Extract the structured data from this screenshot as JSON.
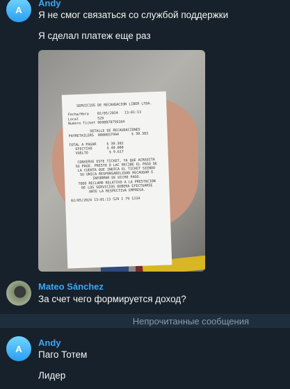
{
  "messages": [
    {
      "sender": "Andy",
      "avatar_letter": "A",
      "lines": [
        "Я не смог связаться со службой поддержки",
        "Я сделал платеж еще раз"
      ],
      "has_photo": true
    },
    {
      "sender": "Mateo Sánchez",
      "lines": [
        "За счет чего формируется доход?"
      ]
    },
    {
      "sender": "Andy",
      "avatar_letter": "A",
      "lines": [
        "Паго Тотем",
        "Лидер"
      ]
    }
  ],
  "unread_divider": "Непрочитанные сообщения",
  "receipt": {
    "header": "SERVICIOS DE RECAUDACION LIBER LTDA.",
    "fecha": "Fecha/Hora    02/05/2024   13:01:13",
    "local": "Local         529",
    "ticket": "Numero Ticket 9690878756164",
    "detalle": "DETALLE DE RECAUDACIONES",
    "payretailers": "PAYRETAILERS  0000037994      $ 30.383",
    "total": "TOTAL A PAGAR     $ 30.383",
    "efectivo": "   EFECTIVO       $ 40.000",
    "vuelto": "   VUELTO          $ 9.617",
    "notice": "CONSERVE ESTE TICKET, YA QUE ACREDITA\nSU PAGO. PRESTO O LAC RECIBE EL PAGO DE\nLA CUENTA QUE INDICA EL TICKET SIENDO\nSU UNICA RESPONSABILIDAD RECAUDAR E\nINFORMAR DE DICHO PAGO.\nTODO RECLAMO RELATIVO A LA PRESTACION\nDE LOS SERVICIOS DEBERA EFECTUARSE\nANTE LA RESPECTIVA EMPRESA.",
    "footer": "02/05/2024 13:01:13 529 1 79 1234"
  },
  "colors": {
    "background": "#17212b",
    "sender_name": "#3aa8f5",
    "divider_bg": "#1f2e3d"
  }
}
